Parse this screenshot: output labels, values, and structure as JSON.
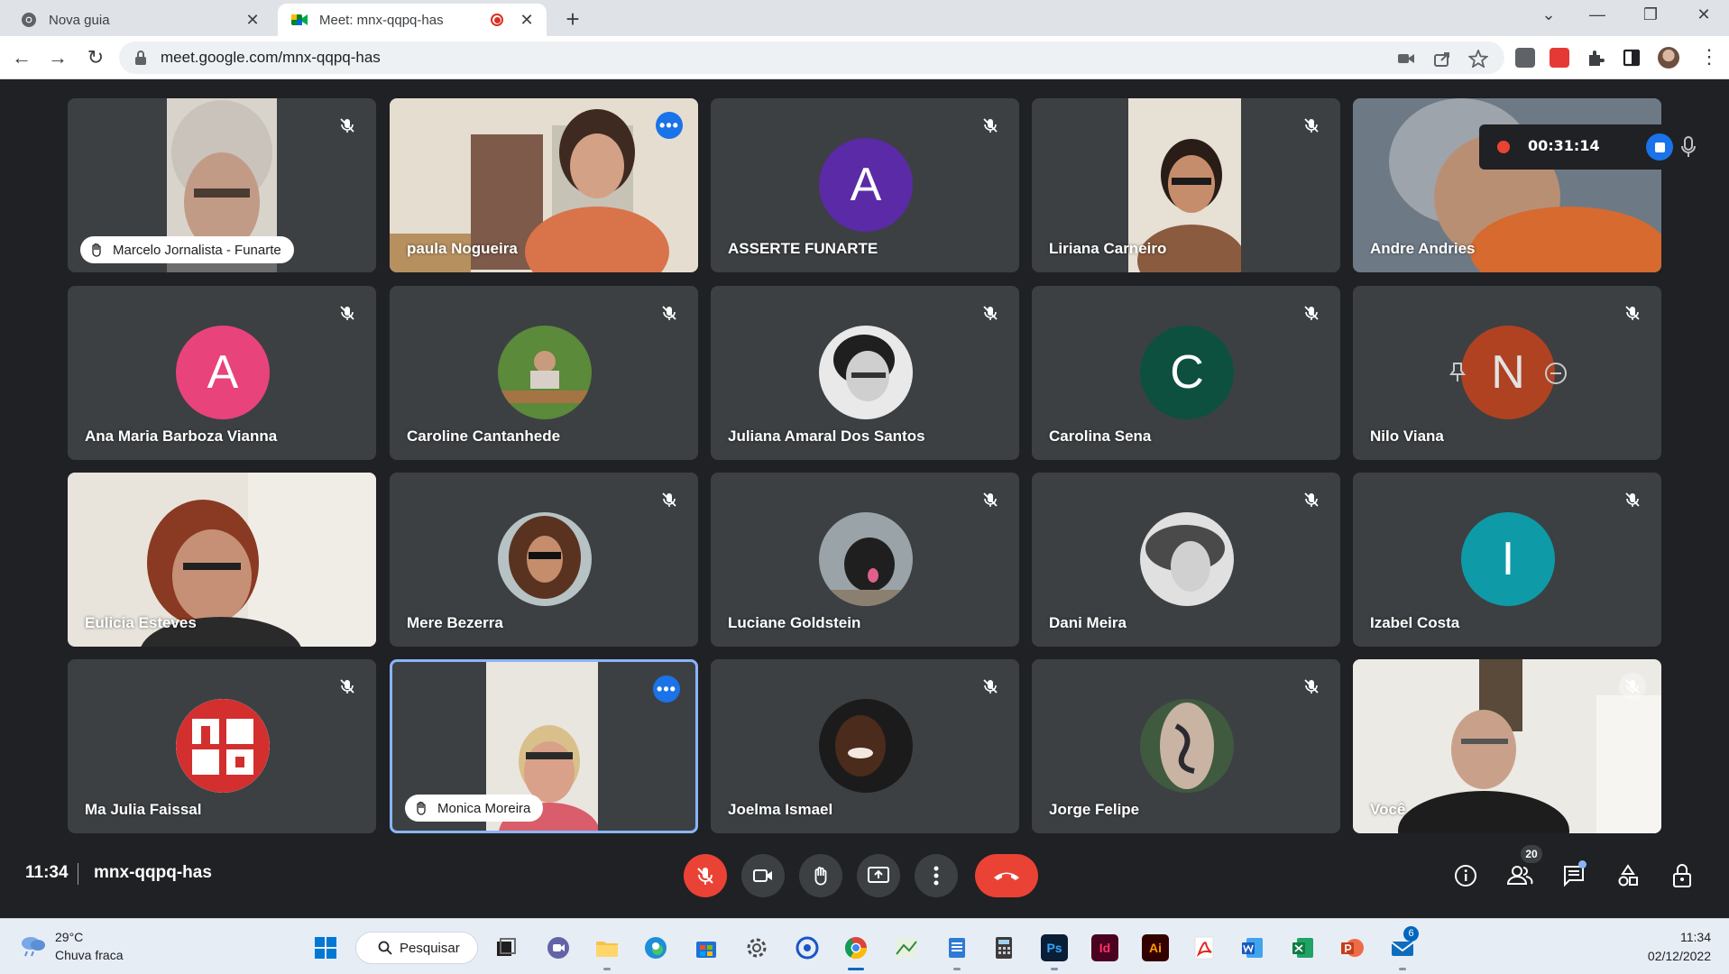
{
  "browser": {
    "tabs": [
      {
        "title": "Nova guia",
        "icon": "chrome-icon",
        "active": false
      },
      {
        "title": "Meet: mnx-qqpq-has",
        "icon": "google-meet-icon",
        "active": true,
        "recording": true
      }
    ],
    "url": "meet.google.com/mnx-qqpq-has"
  },
  "meeting": {
    "time": "11:34",
    "code": "mnx-qqpq-has",
    "recording_time": "00:31:14",
    "participant_count": "20",
    "participants": [
      {
        "name": "Marcelo Jornalista - Funarte",
        "type": "video",
        "hand_raised": true,
        "muted": true
      },
      {
        "name": "paula Nogueira",
        "type": "video",
        "speaking": true
      },
      {
        "name": "ASSERTE FUNARTE",
        "type": "initial",
        "initial": "A",
        "color": "#5b2aa6",
        "muted": true
      },
      {
        "name": "Liriana Carneiro",
        "type": "video",
        "muted": true
      },
      {
        "name": "Andre Andries",
        "type": "video"
      },
      {
        "name": "Ana Maria Barboza Vianna",
        "type": "initial",
        "initial": "A",
        "color": "#e8437a",
        "muted": true
      },
      {
        "name": "Caroline Cantanhede",
        "type": "photo",
        "muted": true
      },
      {
        "name": "Juliana Amaral Dos Santos",
        "type": "photo",
        "muted": true
      },
      {
        "name": "Carolina Sena",
        "type": "initial",
        "initial": "C",
        "color": "#0d5040",
        "muted": true
      },
      {
        "name": "Nilo Viana",
        "type": "initial",
        "initial": "N",
        "color": "#c4431c",
        "muted": true
      },
      {
        "name": "Eulicia Esteves",
        "type": "video"
      },
      {
        "name": "Mere Bezerra",
        "type": "photo",
        "muted": true
      },
      {
        "name": "Luciane Goldstein",
        "type": "photo",
        "muted": true
      },
      {
        "name": "Dani Meira",
        "type": "photo",
        "muted": true
      },
      {
        "name": "Izabel Costa",
        "type": "initial",
        "initial": "I",
        "color": "#0e9aa7",
        "muted": true
      },
      {
        "name": "Ma Julia Faissal",
        "type": "photo",
        "muted": true
      },
      {
        "name": "Monica Moreira",
        "type": "video",
        "hand_raised": true,
        "pinned_highlight": true
      },
      {
        "name": "Joelma Ismael",
        "type": "photo",
        "muted": true
      },
      {
        "name": "Jorge Felipe",
        "type": "photo",
        "muted": true
      },
      {
        "name": "Você",
        "type": "video",
        "muted": true
      }
    ]
  },
  "taskbar": {
    "weather_temp": "29°C",
    "weather_desc": "Chuva fraca",
    "search_label": "Pesquisar",
    "time": "11:34",
    "date": "02/12/2022",
    "mail_badge": "6",
    "apps": [
      "start",
      "search",
      "task-view",
      "teams-chat",
      "file-explorer",
      "edge",
      "store",
      "settings",
      "quick-assist",
      "chrome",
      "map-app",
      "notepad",
      "calculator",
      "photoshop",
      "indesign",
      "illustrator",
      "acrobat",
      "word",
      "excel",
      "powerpoint",
      "mail"
    ],
    "app_labels": {
      "photoshop": "Ps",
      "indesign": "Id",
      "illustrator": "Ai"
    }
  },
  "colors": {
    "meet_bg": "#202124",
    "tile_bg": "#3c4043",
    "accent_blue": "#1a73e8",
    "end_call_red": "#ea4335"
  }
}
